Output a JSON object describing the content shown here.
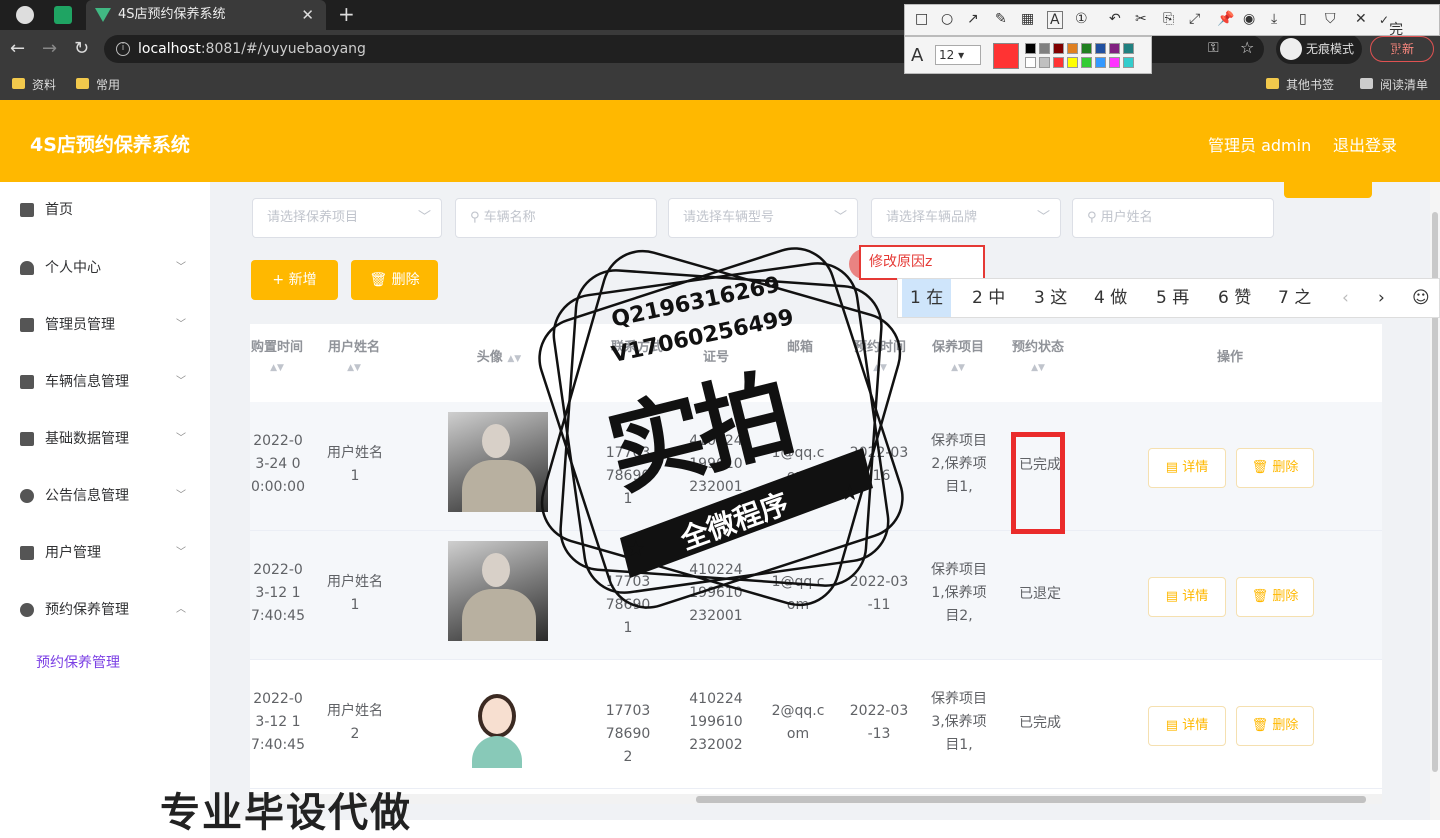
{
  "browser": {
    "tab_title": "4S店预约保养系统",
    "url_host": "localhost",
    "url_rest": ":8081/#/yuyuebaoyang",
    "incognito_label": "无痕模式",
    "update_label": "更新",
    "bookmarks": [
      "资料",
      "常用"
    ],
    "bookmarks_right": [
      "其他书签",
      "阅读清单"
    ]
  },
  "annotation_toolbar": {
    "done_label": "完成",
    "font_size": "12",
    "font_letter": "A"
  },
  "header": {
    "title": "4S店预约保养系统",
    "admin": "管理员 admin",
    "logout": "退出登录"
  },
  "sidebar": {
    "items": [
      {
        "label": "首页",
        "icon": "home-icon"
      },
      {
        "label": "个人中心",
        "icon": "user-icon"
      },
      {
        "label": "管理员管理",
        "icon": "list-icon"
      },
      {
        "label": "车辆信息管理",
        "icon": "building-icon"
      },
      {
        "label": "基础数据管理",
        "icon": "list-icon"
      },
      {
        "label": "公告信息管理",
        "icon": "help-icon"
      },
      {
        "label": "用户管理",
        "icon": "card-icon"
      },
      {
        "label": "预约保养管理",
        "icon": "pin-icon"
      }
    ],
    "subitem": "预约保养管理"
  },
  "filters": {
    "project_placeholder": "请选择保养项目",
    "car_name_placeholder": "车辆名称",
    "car_type_placeholder": "请选择车辆型号",
    "brand_placeholder": "请选择车辆品牌",
    "username_placeholder": "用户姓名"
  },
  "buttons": {
    "add": "新增",
    "delete": "删除",
    "detail": "详情",
    "row_delete": "删除"
  },
  "table": {
    "headers": {
      "buy_time": "购置时间",
      "username": "用户姓名",
      "avatar": "头像",
      "contact": "联系方式",
      "idcard": "证号",
      "email": "邮箱",
      "appoint_time": "预约时间",
      "project": "保养项目",
      "status": "预约状态",
      "ops": "操作"
    },
    "rows": [
      {
        "buy_time": "2022-03-24 00:00:00",
        "username": "用户姓名1",
        "phone": "17703786901",
        "idcard": "410224199610232001",
        "email": "1@qq.com",
        "appoint": "2022-03-16",
        "project": "保养项目2,保养项目1,",
        "status": "已完成"
      },
      {
        "buy_time": "2022-03-12 17:40:45",
        "username": "用户姓名1",
        "phone": "17703786901",
        "idcard": "410224199610232001",
        "email": "1@qq.com",
        "appoint": "2022-03-11",
        "project": "保养项目1,保养项目2,",
        "status": "已退定"
      },
      {
        "buy_time": "2022-03-12 17:40:45",
        "username": "用户姓名2",
        "phone": "17703786902",
        "idcard": "410224199610232002",
        "email": "2@qq.com",
        "appoint": "2022-03-13",
        "project": "保养项目3,保养项目1,",
        "status": "已完成"
      }
    ]
  },
  "ime": {
    "input": "修改原因z",
    "candidates": [
      "1 在",
      "2 中",
      "3 这",
      "4 做",
      "5 再",
      "6 赞",
      "7 之"
    ]
  },
  "watermark": {
    "qq": "Q2196316269",
    "v": "V17060256499",
    "big": "实拍",
    "ribbon": "全微程序",
    "footer": "专业毕设代做"
  },
  "colors": {
    "accent": "#ffb800",
    "status_box": "#ea2b2b",
    "sidebar_sub": "#7b3fe4"
  }
}
